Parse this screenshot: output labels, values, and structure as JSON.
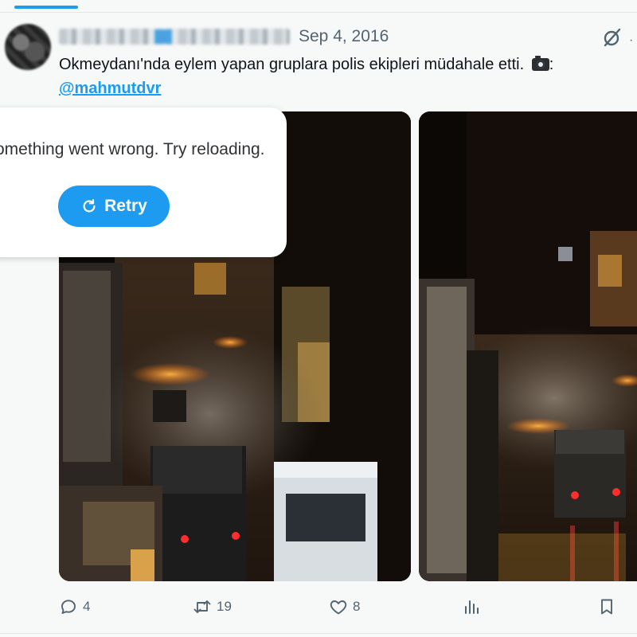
{
  "tweet": {
    "date": "Sep 4, 2016",
    "text": "Okmeydanı'nda eylem yapan gruplara polis ekipleri müdahale etti.",
    "text_suffix": ":",
    "mention": "@mahmutdvr"
  },
  "error": {
    "message": "Something went wrong. Try reloading.",
    "retry_label": "Retry"
  },
  "actions": {
    "reply_count": "4",
    "repost_count": "19",
    "like_count": "8"
  },
  "icons": [
    "grok-icon",
    "more-icon",
    "camera-icon",
    "retry-icon",
    "reply-icon",
    "repost-icon",
    "like-icon",
    "views-icon",
    "bookmark-icon"
  ],
  "colors": {
    "accent": "#1d9bf0",
    "muted": "#536471",
    "background": "#f7f9f9"
  }
}
